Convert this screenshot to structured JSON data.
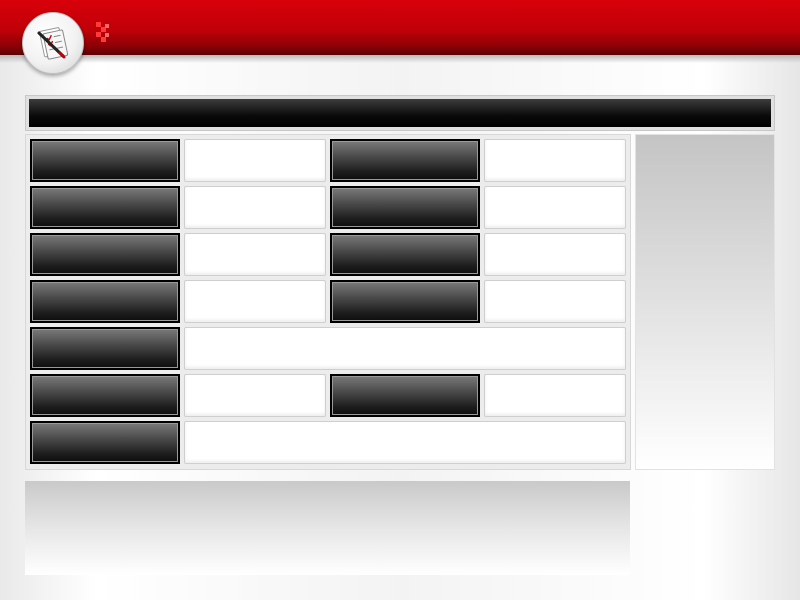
{
  "theme": {
    "accent_red": "#c00008",
    "header_dark_red": "#5a0004",
    "title_bar_black": "#000000"
  },
  "logo": {
    "icon": "checklist-pencil-icon"
  },
  "header_decoration": {
    "icon": "checker-pattern-icon"
  },
  "title_bar": {
    "text": ""
  },
  "table": {
    "rows": [
      [
        {
          "kind": "dark",
          "span": 1,
          "text": ""
        },
        {
          "kind": "light",
          "span": 1,
          "text": ""
        },
        {
          "kind": "dark",
          "span": 1,
          "text": ""
        },
        {
          "kind": "light",
          "span": 1,
          "text": ""
        }
      ],
      [
        {
          "kind": "dark",
          "span": 1,
          "text": ""
        },
        {
          "kind": "light",
          "span": 1,
          "text": ""
        },
        {
          "kind": "dark",
          "span": 1,
          "text": ""
        },
        {
          "kind": "light",
          "span": 1,
          "text": ""
        }
      ],
      [
        {
          "kind": "dark",
          "span": 1,
          "text": ""
        },
        {
          "kind": "light",
          "span": 1,
          "text": ""
        },
        {
          "kind": "dark",
          "span": 1,
          "text": ""
        },
        {
          "kind": "light",
          "span": 1,
          "text": ""
        }
      ],
      [
        {
          "kind": "dark",
          "span": 1,
          "text": ""
        },
        {
          "kind": "light",
          "span": 1,
          "text": ""
        },
        {
          "kind": "dark",
          "span": 1,
          "text": ""
        },
        {
          "kind": "light",
          "span": 1,
          "text": ""
        }
      ],
      [
        {
          "kind": "dark",
          "span": 1,
          "text": ""
        },
        {
          "kind": "light",
          "span": 3,
          "text": ""
        }
      ],
      [
        {
          "kind": "dark",
          "span": 1,
          "text": ""
        },
        {
          "kind": "light",
          "span": 1,
          "text": ""
        },
        {
          "kind": "dark",
          "span": 1,
          "text": ""
        },
        {
          "kind": "light",
          "span": 1,
          "text": ""
        }
      ],
      [
        {
          "kind": "dark",
          "span": 1,
          "text": ""
        },
        {
          "kind": "light",
          "span": 3,
          "text": ""
        }
      ]
    ]
  },
  "side_panel": {
    "text": ""
  },
  "bottom_panel": {
    "text": ""
  }
}
